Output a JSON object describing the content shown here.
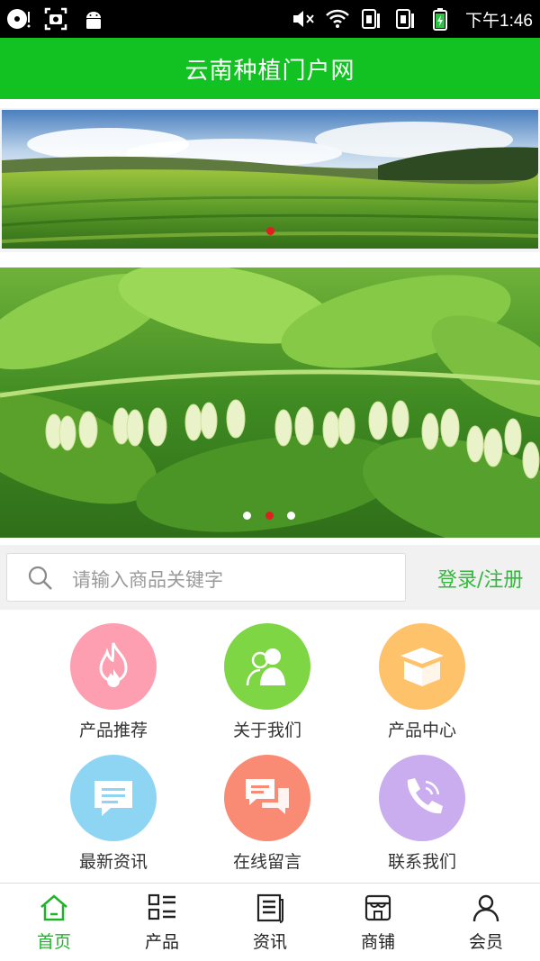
{
  "status_bar": {
    "time": "下午1:46"
  },
  "header": {
    "title": "云南种植门户网"
  },
  "search": {
    "placeholder": "请输入商品关键字",
    "login_label": "登录/注册"
  },
  "grid": [
    {
      "label": "产品推荐",
      "icon": "fire-icon",
      "color": "#fd9fb1"
    },
    {
      "label": "关于我们",
      "icon": "people-icon",
      "color": "#7fd644"
    },
    {
      "label": "产品中心",
      "icon": "box-icon",
      "color": "#fec26b"
    },
    {
      "label": "最新资讯",
      "icon": "message-icon",
      "color": "#8ed5f4"
    },
    {
      "label": "在线留言",
      "icon": "chat-icon",
      "color": "#f98b74"
    },
    {
      "label": "联系我们",
      "icon": "phone-icon",
      "color": "#caadee"
    }
  ],
  "tabs": [
    {
      "label": "首页",
      "icon": "home-icon",
      "active": true
    },
    {
      "label": "产品",
      "icon": "list-icon",
      "active": false
    },
    {
      "label": "资讯",
      "icon": "news-icon",
      "active": false
    },
    {
      "label": "商铺",
      "icon": "shop-icon",
      "active": false
    },
    {
      "label": "会员",
      "icon": "user-icon",
      "active": false
    }
  ],
  "colors": {
    "brand": "#12c222",
    "active_tab": "#1fb32a",
    "dot_active": "#e02020"
  }
}
